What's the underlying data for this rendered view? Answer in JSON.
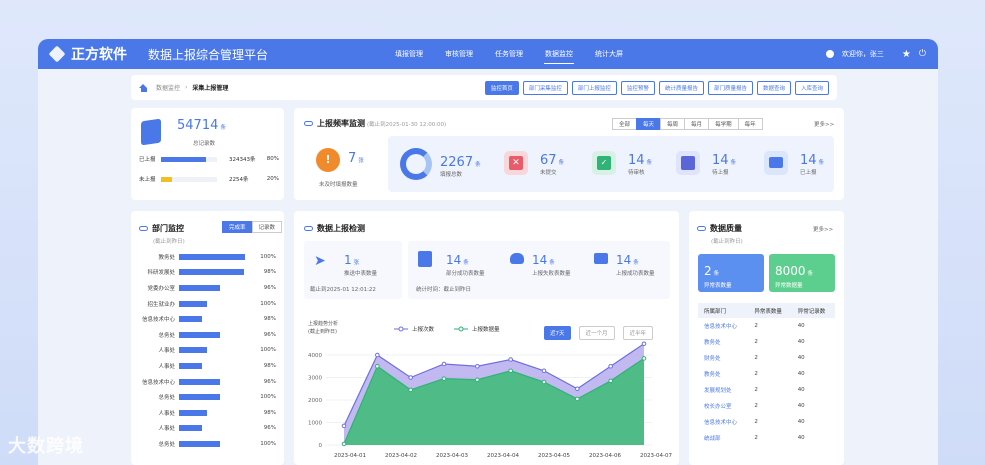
{
  "header": {
    "brand": "正方软件",
    "system_title": "数据上报综合管理平台",
    "nav": [
      "填报管理",
      "审核管理",
      "任务管理",
      "数据监控",
      "统计大屏"
    ],
    "active_nav": 3,
    "greeting": "欢迎你，张三"
  },
  "breadcrumb": {
    "parent": "数据监控",
    "current": "采集上报管理",
    "tabs": [
      "监控首页",
      "部门采集监控",
      "部门上报监控",
      "监控预警",
      "统计质量报告",
      "部门质量报告",
      "数据查询",
      "入库查询"
    ],
    "active_tab": 0
  },
  "summary": {
    "total": "54714",
    "unit": "条",
    "total_label": "总记录数",
    "reported_label": "已上报",
    "reported_value": "324343条",
    "reported_pct": "80%",
    "reported_frac": 0.8,
    "unreported_label": "未上报",
    "unreported_value": "2254条",
    "unreported_pct": "20%",
    "unreported_frac": 0.2
  },
  "frequency": {
    "title": "上报频率监测",
    "as_of": "(截止到2025-01-30 12:00:00)",
    "filters": [
      "全部",
      "每天",
      "每周",
      "每月",
      "每学期",
      "每年"
    ],
    "active_filter": 1,
    "more": "更多>>",
    "overdue_value": "7",
    "overdue_unit": "张",
    "overdue_label": "未及时填报数量",
    "stats": [
      {
        "value": "2267",
        "unit": "条",
        "label": "填报总数",
        "icon": "donut-progress-icon"
      },
      {
        "value": "67",
        "unit": "条",
        "label": "未提交",
        "icon": "close-doc-icon"
      },
      {
        "value": "14",
        "unit": "条",
        "label": "待审核",
        "icon": "check-list-icon"
      },
      {
        "value": "14",
        "unit": "条",
        "label": "待上报",
        "icon": "clock-doc-icon"
      },
      {
        "value": "14",
        "unit": "条",
        "label": "已上报",
        "icon": "monitor-icon"
      }
    ]
  },
  "dept": {
    "title": "部门监控",
    "sub": "(截止到昨日)",
    "toggle": [
      "完成率",
      "记录数"
    ],
    "rows": [
      {
        "name": "教务处",
        "pct": "100%",
        "frac": 1.0
      },
      {
        "name": "科研发展处",
        "pct": "98%",
        "frac": 0.98
      },
      {
        "name": "党委办公室",
        "pct": "96%",
        "frac": 0.62
      },
      {
        "name": "招生就业办",
        "pct": "100%",
        "frac": 0.42
      },
      {
        "name": "信息技术中心",
        "pct": "98%",
        "frac": 0.35
      },
      {
        "name": "总务处",
        "pct": "96%",
        "frac": 0.62
      },
      {
        "name": "人事处",
        "pct": "100%",
        "frac": 0.42
      },
      {
        "name": "人事处",
        "pct": "98%",
        "frac": 0.35
      },
      {
        "name": "信息技术中心",
        "pct": "96%",
        "frac": 0.62
      },
      {
        "name": "总务处",
        "pct": "100%",
        "frac": 0.62
      },
      {
        "name": "人事处",
        "pct": "98%",
        "frac": 0.42
      },
      {
        "name": "人事处",
        "pct": "96%",
        "frac": 0.35
      },
      {
        "name": "总务处",
        "pct": "100%",
        "frac": 0.62
      }
    ]
  },
  "detect": {
    "title": "数据上报检测",
    "push_value": "1",
    "push_unit": "张",
    "push_label": "推送中表数量",
    "push_time": "截止到2025-01 12:01:22",
    "partial_value": "14",
    "partial_unit": "条",
    "partial_label": "部分成功表数量",
    "fail_value": "14",
    "fail_unit": "条",
    "fail_label": "上报失败表数量",
    "ok_value": "14",
    "ok_unit": "条",
    "ok_label": "上报成功表数量",
    "stat_time": "统计时间：截止到昨日",
    "range_buttons": [
      "近7天",
      "近一个月",
      "近半年"
    ],
    "active_range": 0
  },
  "chart_data": {
    "type": "area",
    "ylabel": "上报趋势分析\n(截止到昨日)",
    "x": [
      "2023-04-01",
      "2023-04-02",
      "2023-04-03",
      "2023-04-04",
      "2023-04-05",
      "2023-04-06",
      "2023-04-07"
    ],
    "ylim": [
      0,
      4000
    ],
    "yticks": [
      "4000",
      "3000",
      "2000",
      "1000",
      "0"
    ],
    "series": [
      {
        "name": "上报次数",
        "color": "#6f6fe0",
        "values": [
          850,
          4000,
          3000,
          3600,
          3500,
          3800,
          3300,
          2500,
          3500,
          4500
        ]
      },
      {
        "name": "上报数据量",
        "color": "#2fb377",
        "values": [
          50,
          3500,
          2450,
          2950,
          2900,
          3300,
          2800,
          2050,
          2850,
          3850
        ]
      }
    ]
  },
  "quality": {
    "title": "数据质量",
    "sub": "(截止到昨日)",
    "more": "更多>>",
    "abnormal_tables": "2",
    "abnormal_tables_unit": "条",
    "abnormal_tables_label": "异常表数量",
    "abnormal_data": "8000",
    "abnormal_data_unit": "条",
    "abnormal_data_label": "异常数据量",
    "columns": [
      "所属部门",
      "异常表数量",
      "异常记录数"
    ],
    "rows": [
      [
        "信息技术中心",
        "2",
        "40"
      ],
      [
        "教务处",
        "2",
        "40"
      ],
      [
        "财务处",
        "2",
        "40"
      ],
      [
        "教务处",
        "2",
        "40"
      ],
      [
        "发展规划处",
        "2",
        "40"
      ],
      [
        "校长办公室",
        "2",
        "40"
      ],
      [
        "信息技术中心",
        "2",
        "40"
      ],
      [
        "统战部",
        "2",
        "40"
      ]
    ]
  },
  "watermark": "大数跨境"
}
